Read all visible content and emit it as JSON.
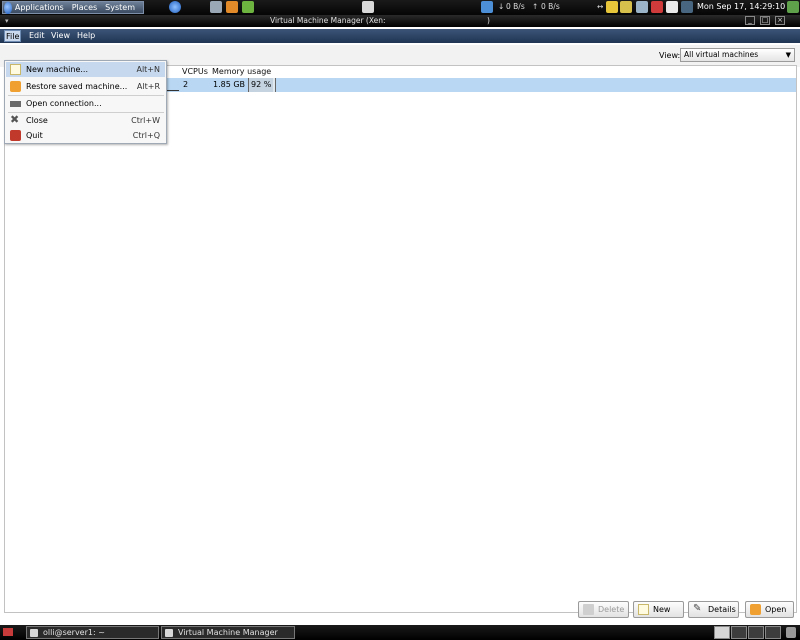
{
  "top_panel": {
    "menus": [
      "Applications",
      "Places",
      "System"
    ],
    "net_down": "0 B/s",
    "net_up": "0 B/s",
    "clock": "Mon Sep 17, 14:29:10"
  },
  "window": {
    "title": "Virtual Machine Manager (Xen:",
    "title_end": ")"
  },
  "menubar": [
    "File",
    "Edit",
    "View",
    "Help"
  ],
  "file_menu": [
    {
      "label": "New machine...",
      "accel": "Alt+N"
    },
    {
      "label": "Restore saved machine...",
      "accel": "Alt+R"
    },
    {
      "label": "Open connection...",
      "accel": ""
    },
    {
      "label": "Close",
      "accel": "Ctrl+W"
    },
    {
      "label": "Quit",
      "accel": "Ctrl+Q"
    }
  ],
  "view_filter": {
    "label": "View:",
    "selected": "All virtual machines"
  },
  "columns": {
    "vcpus": "VCPUs",
    "memory": "Memory usage"
  },
  "vm_row": {
    "vcpus": "2",
    "memory": "1.85 GB",
    "memory_percent": "92 %",
    "memory_fraction": 0.92
  },
  "buttons": {
    "delete": "Delete",
    "new": "New",
    "details": "Details",
    "open": "Open"
  },
  "taskbar": {
    "terminal": "olli@server1: ~",
    "vmm": "Virtual Machine Manager (X..."
  },
  "colors": {
    "selection": "#b9d7f2",
    "menu_highlight": "#c6d8ee",
    "menubar": "#203553"
  }
}
